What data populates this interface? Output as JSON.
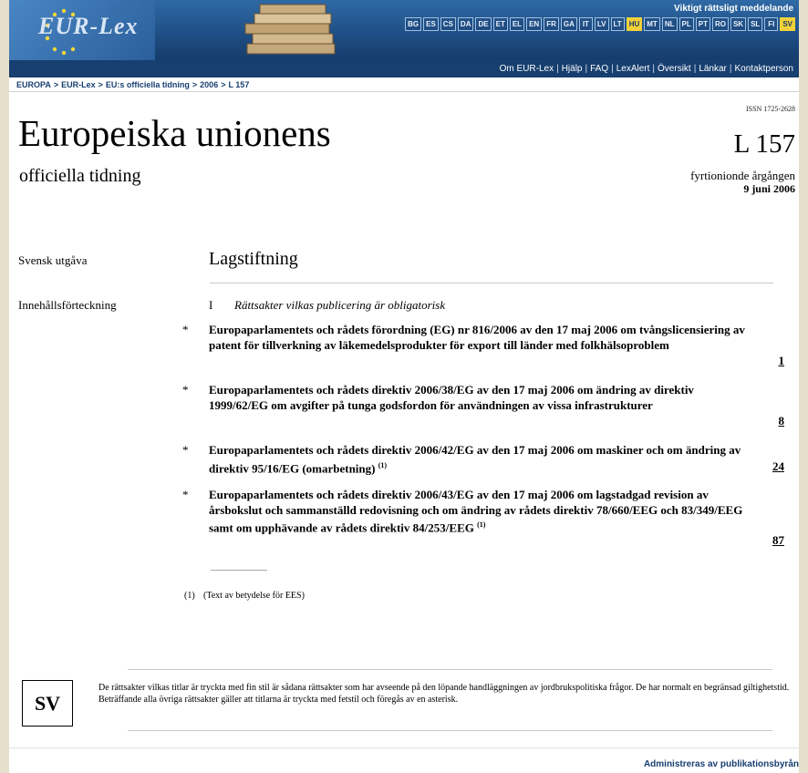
{
  "header": {
    "logo_text": "EUR-Lex",
    "important_notice": "Viktigt rättsligt meddelande",
    "languages": [
      "BG",
      "ES",
      "CS",
      "DA",
      "DE",
      "ET",
      "EL",
      "EN",
      "FR",
      "GA",
      "IT",
      "LV",
      "LT",
      "HU",
      "MT",
      "NL",
      "PL",
      "PT",
      "RO",
      "SK",
      "SL",
      "FI",
      "SV"
    ],
    "active_languages": [
      "HU",
      "SV"
    ],
    "nav_links": [
      "Om EUR-Lex",
      "Hjälp",
      "FAQ",
      "LexAlert",
      "Översikt",
      "Länkar",
      "Kontaktperson"
    ]
  },
  "breadcrumb": [
    "EUROPA",
    "EUR-Lex",
    "EU:s officiella tidning",
    "2006",
    "L 157"
  ],
  "masthead": {
    "issn": "ISSN 1725-2628",
    "title": "Europeiska unionens",
    "subtitle": "officiella tidning",
    "issue": "L 157",
    "year_text": "fyrtionionde årgången",
    "date": "9 juni 2006"
  },
  "content": {
    "edition_label": "Svensk utgåva",
    "section_heading": "Lagstiftning",
    "toc_label": "Innehållsförteckning",
    "part_roman": "I",
    "part_title": "Rättsakter vilkas publicering är obligatorisk",
    "entries": [
      {
        "marker": "*",
        "text": "Europaparlamentets och rådets förordning (EG) nr 816/2006 av den 17 maj 2006 om tvångslicensiering av patent för tillverkning av läkemedelsprodukter för export till länder med folkhälsoproblem",
        "note": "",
        "page": "1"
      },
      {
        "marker": "*",
        "text": "Europaparlamentets och rådets direktiv 2006/38/EG av den 17 maj 2006 om ändring av direktiv 1999/62/EG om avgifter på tunga godsfordon för användningen av vissa infrastrukturer",
        "note": "",
        "page": "8"
      },
      {
        "marker": "*",
        "text": "Europaparlamentets och rådets direktiv 2006/42/EG av den 17 maj 2006 om maskiner och om ändring av direktiv 95/16/EG (omarbetning)",
        "note": "(1)",
        "page": "24"
      },
      {
        "marker": "*",
        "text": "Europaparlamentets och rådets direktiv 2006/43/EG av den 17 maj 2006 om lagstadgad revision av årsbokslut och sammanställd redovisning och om ändring av rådets direktiv 78/660/EEG och 83/349/EEG samt om upphävande av rådets direktiv 84/253/EEG",
        "note": "(1)",
        "page": "87"
      }
    ],
    "footnote_num": "(1)",
    "footnote_text": "(Text av betydelse för EES)"
  },
  "footer": {
    "language_code": "SV",
    "note_line1": "De rättsakter vilkas titlar är tryckta med fin stil är sådana rättsakter som har avseende på den löpande handläggningen av jordbrukspolitiska frågor. De har normalt en begränsad giltighetstid.",
    "note_line2": "Beträffande alla övriga rättsakter gäller att titlarna är tryckta med fetstil och föregås av en asterisk.",
    "admin_link": "Administreras av publikationsbyrån"
  },
  "colors": {
    "banner": "#1f4f86",
    "nav_strip": "#173f70",
    "active_language": "#f1d13a",
    "outer_background": "#e6dfcb"
  }
}
